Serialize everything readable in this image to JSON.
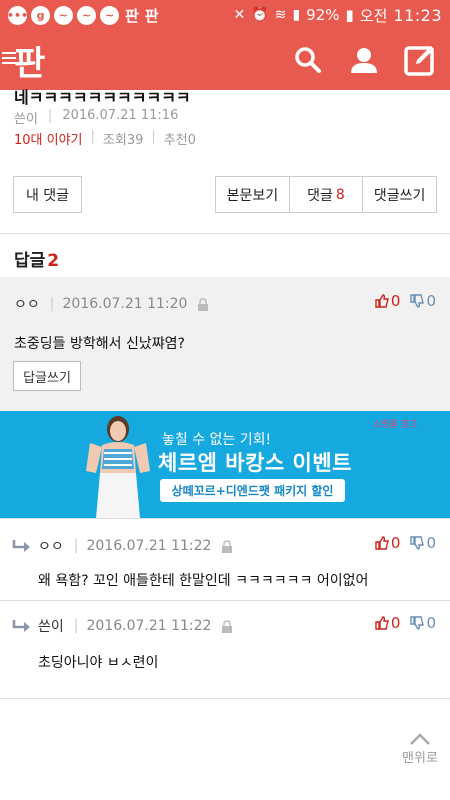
{
  "status_bar": {
    "icons_left": [
      "notification-dots-icon",
      "g-icon",
      "messenger-icon",
      "messenger-icon",
      "messenger-icon"
    ],
    "app_badges": [
      "판",
      "판"
    ],
    "battery": "92%",
    "ampm": "오전",
    "time": "11:23"
  },
  "app_bar": {
    "logo": "판"
  },
  "post": {
    "title": "네ㅋㅋㅋㅋㅋㅋㅋㅋㅋㅋㅋ",
    "author": "쓴이",
    "date": "2016.07.21 11:16",
    "category": "10대 이야기",
    "views": "조회39",
    "recommends": "추천0"
  },
  "actions": {
    "my_comment": "내 댓글",
    "view_body": "본문보기",
    "comments": "댓글",
    "comments_count": "8",
    "write_comment": "댓글쓰기"
  },
  "replies": {
    "label": "답글",
    "count": "2"
  },
  "main_comment": {
    "author": "ㅇㅇ",
    "date": "2016.07.21 11:20",
    "upvotes": "0",
    "downvotes": "0",
    "body": "초중딩들 방학해서 신났쨔염?",
    "reply_button": "답글쓰기"
  },
  "ad": {
    "tag": "쇼핑몰 광고",
    "line1": "놓칠 수 없는 기회!",
    "line2": "체르엠 바캉스 이벤트",
    "line3": "상떼꼬르+디엔드팻 패키지 할인"
  },
  "sub_comments": [
    {
      "author": "ㅇㅇ",
      "date": "2016.07.21 11:22",
      "upvotes": "0",
      "downvotes": "0",
      "body": "왜 욕함? 꼬인 애들한테 한말인데 ㅋㅋㅋㅋㅋㅋ 어이없어"
    },
    {
      "author": "쓴이",
      "date": "2016.07.21 11:22",
      "upvotes": "0",
      "downvotes": "0",
      "body": "초딩아니야 ㅂㅅ련이"
    }
  ],
  "scroll_top_label": "맨위로",
  "colors": {
    "brand": "#e85a4f",
    "accent_red": "#d0221a",
    "ad_bg": "#16a9df"
  }
}
